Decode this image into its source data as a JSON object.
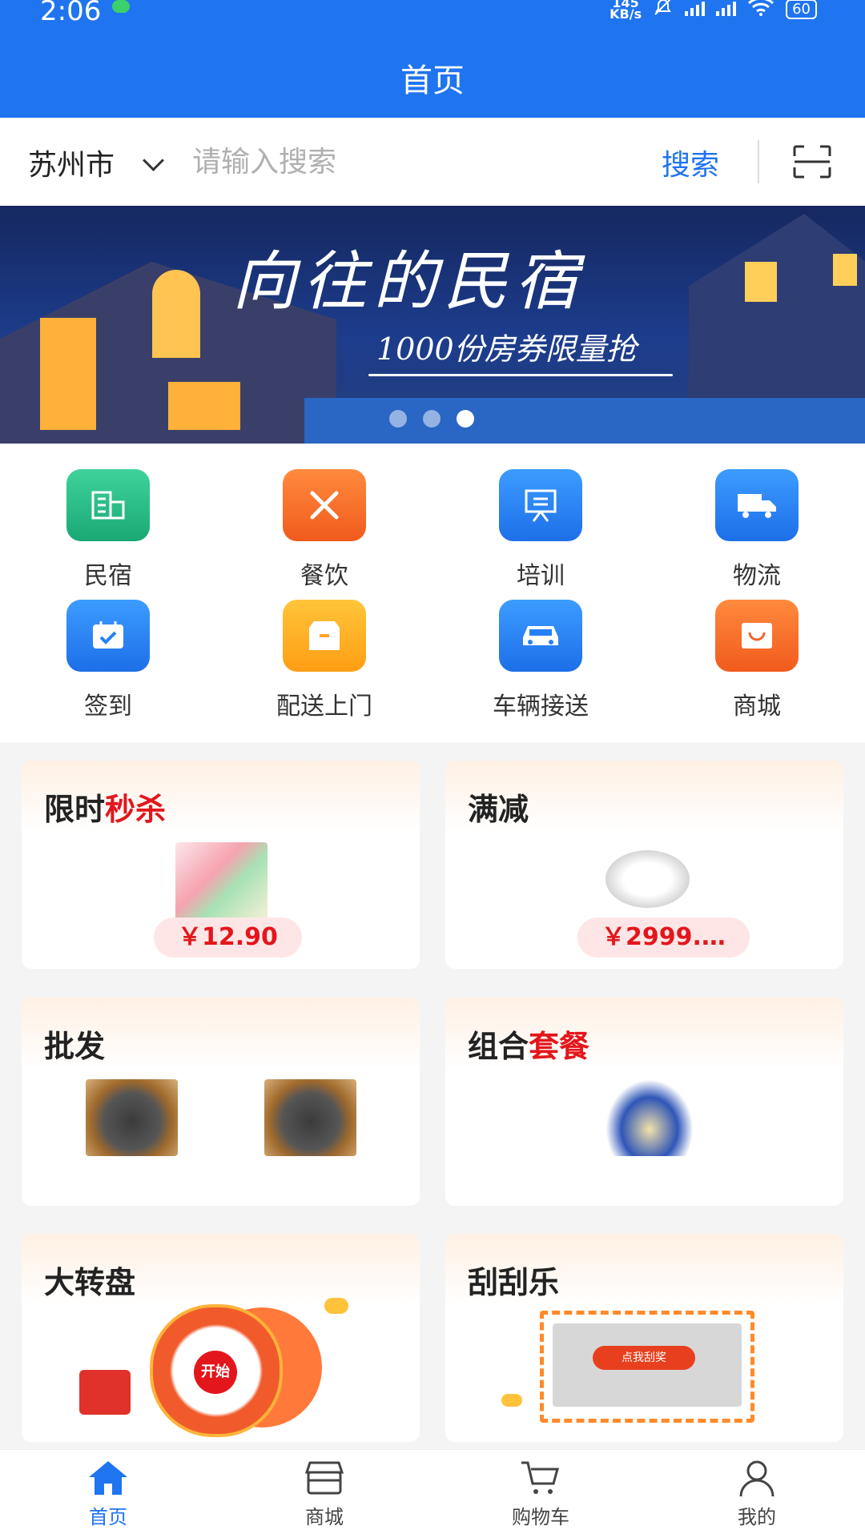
{
  "status_bar": {
    "time": "2:06",
    "net_speed_value": "145",
    "net_speed_unit": "KB/s",
    "battery": "60"
  },
  "header": {
    "title": "首页"
  },
  "search": {
    "city": "苏州市",
    "placeholder": "请输入搜索",
    "button_label": "搜索"
  },
  "banner": {
    "title": "向往的民宿",
    "subtitle": "1000份房券限量抢",
    "dot_count": 3,
    "active_dot": 3
  },
  "categories": [
    {
      "label": "民宿",
      "icon": "building-icon",
      "color": "#1fb07f"
    },
    {
      "label": "餐饮",
      "icon": "utensils-icon",
      "color": "#f2642a"
    },
    {
      "label": "培训",
      "icon": "easel-icon",
      "color": "#2480f5"
    },
    {
      "label": "物流",
      "icon": "truck-icon",
      "color": "#2480f5"
    },
    {
      "label": "签到",
      "icon": "calendar-check-icon",
      "color": "#2480f5"
    },
    {
      "label": "配送上门",
      "icon": "box-icon",
      "color": "#ffa51f"
    },
    {
      "label": "车辆接送",
      "icon": "car-icon",
      "color": "#2480f5"
    },
    {
      "label": "商城",
      "icon": "shopping-bag-icon",
      "color": "#f2642a"
    }
  ],
  "promos": {
    "flash_sale": {
      "title_main": "限时",
      "title_highlight": "秒杀",
      "price": "￥12.90"
    },
    "discount": {
      "title_main": "满减",
      "price": "￥2999.…"
    },
    "wholesale": {
      "title_main": "批发"
    },
    "combo": {
      "title_main": "组合",
      "title_highlight": "套餐"
    },
    "wheel": {
      "title_main": "大转盘",
      "wheel_text": "开始"
    },
    "scratch": {
      "title_main": "刮刮乐",
      "button_label": "点我刮奖"
    }
  },
  "tabs": [
    {
      "label": "首页",
      "icon": "home-icon",
      "active": true
    },
    {
      "label": "商城",
      "icon": "store-icon",
      "active": false
    },
    {
      "label": "购物车",
      "icon": "cart-icon",
      "active": false
    },
    {
      "label": "我的",
      "icon": "user-icon",
      "active": false
    }
  ],
  "colors": {
    "primary": "#1f74f0",
    "highlight_red": "#e3161c"
  }
}
